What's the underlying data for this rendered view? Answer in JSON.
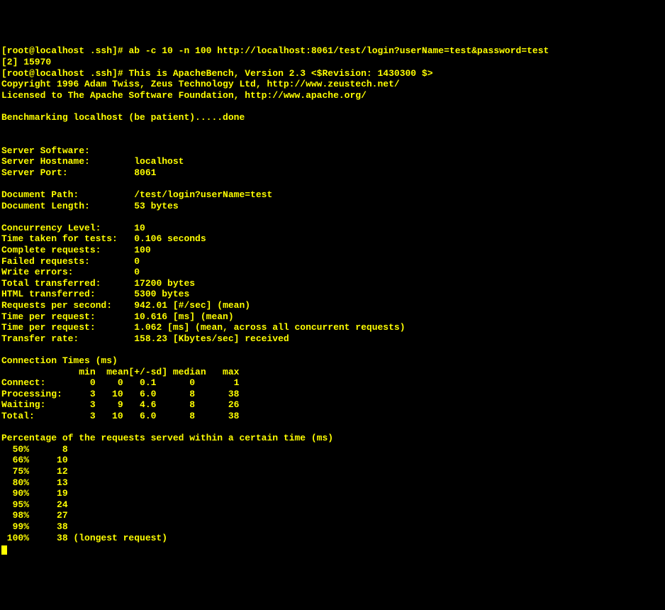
{
  "prompt1": "[root@localhost .ssh]# ",
  "command1": "ab -c 10 -n 100 http://localhost:8061/test/login?userName=test&password=test",
  "bg_line": "[2] 15970",
  "prompt2": "[root@localhost .ssh]# ",
  "header1": "This is ApacheBench, Version 2.3 <$Revision: 1430300 $>",
  "header2": "Copyright 1996 Adam Twiss, Zeus Technology Ltd, http://www.zeustech.net/",
  "header3": "Licensed to The Apache Software Foundation, http://www.apache.org/",
  "benchmarking": "Benchmarking localhost (be patient).....done",
  "kv": {
    "server_software_l": "Server Software:",
    "server_software_v": "",
    "server_hostname_l": "Server Hostname:",
    "server_hostname_v": "localhost",
    "server_port_l": "Server Port:",
    "server_port_v": "8061",
    "document_path_l": "Document Path:",
    "document_path_v": "/test/login?userName=test",
    "document_length_l": "Document Length:",
    "document_length_v": "53 bytes",
    "concurrency_level_l": "Concurrency Level:",
    "concurrency_level_v": "10",
    "time_taken_l": "Time taken for tests:",
    "time_taken_v": "0.106 seconds",
    "complete_requests_l": "Complete requests:",
    "complete_requests_v": "100",
    "failed_requests_l": "Failed requests:",
    "failed_requests_v": "0",
    "write_errors_l": "Write errors:",
    "write_errors_v": "0",
    "total_transferred_l": "Total transferred:",
    "total_transferred_v": "17200 bytes",
    "html_transferred_l": "HTML transferred:",
    "html_transferred_v": "5300 bytes",
    "rps_l": "Requests per second:",
    "rps_v": "942.01 [#/sec] (mean)",
    "tpr1_l": "Time per request:",
    "tpr1_v": "10.616 [ms] (mean)",
    "tpr2_l": "Time per request:",
    "tpr2_v": "1.062 [ms] (mean, across all concurrent requests)",
    "transfer_rate_l": "Transfer rate:",
    "transfer_rate_v": "158.23 [Kbytes/sec] received"
  },
  "conn_times_header": "Connection Times (ms)",
  "conn_times_cols": "              min  mean[+/-sd] median   max",
  "conn_connect": "Connect:        0    0   0.1      0       1",
  "conn_processing": "Processing:     3   10   6.0      8      38",
  "conn_waiting": "Waiting:        3    9   4.6      8      26",
  "conn_total": "Total:          3   10   6.0      8      38",
  "pct_header": "Percentage of the requests served within a certain time (ms)",
  "pct": {
    "p50": "  50%      8",
    "p66": "  66%     10",
    "p75": "  75%     12",
    "p80": "  80%     13",
    "p90": "  90%     19",
    "p95": "  95%     24",
    "p98": "  98%     27",
    "p99": "  99%     38",
    "p100": " 100%     38 (longest request)"
  },
  "chart_data": {
    "type": "table",
    "title": "ApacheBench results",
    "server": {
      "hostname": "localhost",
      "port": 8061,
      "path": "/test/login?userName=test",
      "document_length_bytes": 53
    },
    "concurrency": 10,
    "n_requests": 100,
    "time_taken_s": 0.106,
    "complete": 100,
    "failed": 0,
    "write_errors": 0,
    "total_transferred_bytes": 17200,
    "html_transferred_bytes": 5300,
    "requests_per_second": 942.01,
    "time_per_request_ms_mean": 10.616,
    "time_per_request_ms_mean_across_concurrent": 1.062,
    "transfer_rate_kbytes_per_sec": 158.23,
    "connection_times_ms": {
      "columns": [
        "min",
        "mean",
        "sd",
        "median",
        "max"
      ],
      "connect": [
        0,
        0,
        0.1,
        0,
        1
      ],
      "processing": [
        3,
        10,
        6.0,
        8,
        38
      ],
      "waiting": [
        3,
        9,
        4.6,
        8,
        26
      ],
      "total": [
        3,
        10,
        6.0,
        8,
        38
      ]
    },
    "percentiles_ms": {
      "50": 8,
      "66": 10,
      "75": 12,
      "80": 13,
      "90": 19,
      "95": 24,
      "98": 27,
      "99": 38,
      "100": 38
    }
  }
}
